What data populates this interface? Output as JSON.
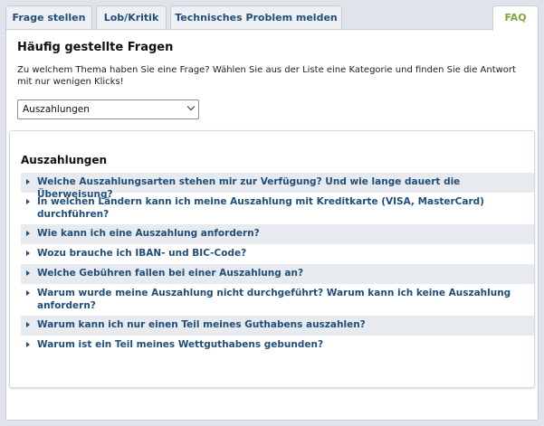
{
  "tabs": [
    {
      "label": "Frage stellen"
    },
    {
      "label": "Lob/Kritik"
    },
    {
      "label": "Technisches Problem melden"
    },
    {
      "label": "FAQ"
    }
  ],
  "heading": "Häufig gestellte Fragen",
  "intro": "Zu welchem Thema haben Sie eine Frage? Wählen Sie aus der Liste eine Kategorie und finden Sie die Antwort mit nur wenigen Klicks!",
  "category_select": {
    "selected": "Auszahlungen"
  },
  "category_title": "Auszahlungen",
  "questions": [
    {
      "text": "Welche Auszahlungsarten stehen mir zur Verfügung? Und wie lange dauert die Überweisung?"
    },
    {
      "text": "In welchen Ländern kann ich meine Auszahlung mit Kreditkarte (VISA, MasterCard) durchführen?"
    },
    {
      "text": "Wie kann ich eine Auszahlung anfordern?"
    },
    {
      "text": "Wozu brauche ich IBAN- und BIC-Code?"
    },
    {
      "text": "Welche Gebühren fallen bei einer Auszahlung an?"
    },
    {
      "text": "Warum wurde meine Auszahlung nicht durchgeführt? Warum kann ich keine Auszahlung anfordern?"
    },
    {
      "text": "Warum kann ich nur einen Teil meines Guthabens auszahlen?"
    },
    {
      "text": "Warum ist ein Teil meines Wettguthabens gebunden?"
    }
  ],
  "colors": {
    "link": "#1f4e7a",
    "active_tab": "#7fa83a",
    "row_shade": "#e7eaee",
    "background": "#dfe3ea"
  }
}
